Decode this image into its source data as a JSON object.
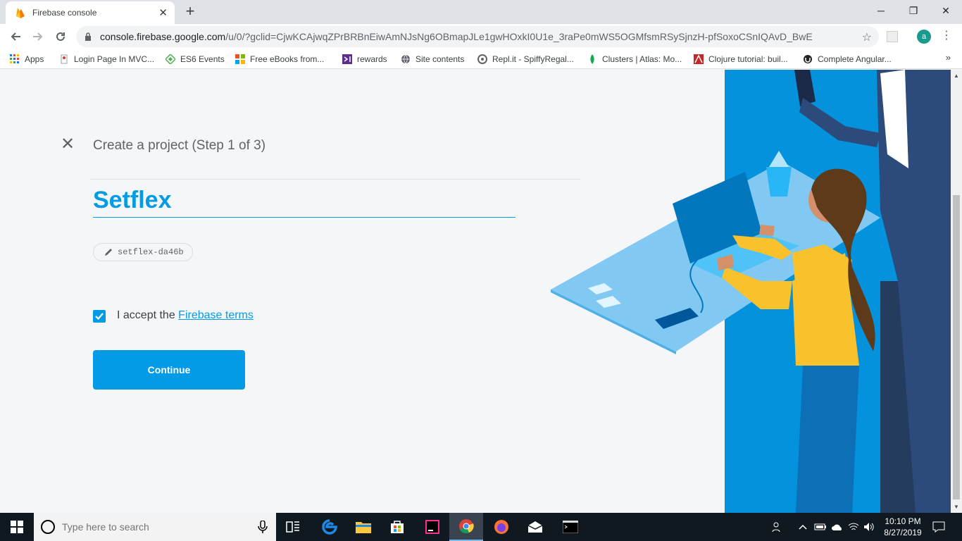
{
  "browser": {
    "tab_title": "Firebase console",
    "tab_close": "✕",
    "new_tab": "+",
    "url_host": "console.firebase.google.com",
    "url_path": "/u/0/?gclid=CjwKCAjwqZPrBRBnEiwAmNJsNg6OBmapJLe1gwHOxkI0U1e_3raPe0mWS5OGMfsmRSySjnzH-pfSoxoCSnIQAvD_BwE",
    "profile_initial": "a",
    "minimize": "─",
    "maximize": "❐",
    "close": "✕",
    "bookmarks_more": "»"
  },
  "bookmarks": [
    {
      "label": "Apps",
      "icon": "apps-grid-icon"
    },
    {
      "label": "Login Page In MVC...",
      "icon": "page-icon"
    },
    {
      "label": "ES6 Events",
      "icon": "diamond-icon"
    },
    {
      "label": "Free eBooks from...",
      "icon": "microsoft-icon"
    },
    {
      "label": "rewards",
      "icon": "vs-icon"
    },
    {
      "label": "Site contents",
      "icon": "globe-icon"
    },
    {
      "label": "Repl.it - SpiffyRegal...",
      "icon": "replit-icon"
    },
    {
      "label": "Clusters | Atlas: Mo...",
      "icon": "mongodb-leaf-icon"
    },
    {
      "label": "Clojure tutorial: buil...",
      "icon": "clojure-icon"
    },
    {
      "label": "Complete Angular...",
      "icon": "udemy-icon"
    }
  ],
  "form": {
    "step_title": "Create a project (Step 1 of 3)",
    "project_name": "Setflex",
    "project_id": "setflex-da46b",
    "terms_prefix": "I accept the ",
    "terms_link": "Firebase terms",
    "terms_checked": true,
    "continue_label": "Continue"
  },
  "taskbar": {
    "search_placeholder": "Type here to search",
    "time": "10:10 PM",
    "date": "8/27/2019"
  },
  "colors": {
    "accent": "#039be5",
    "illustration_bg": "#0288d1",
    "taskbar": "#101820"
  }
}
